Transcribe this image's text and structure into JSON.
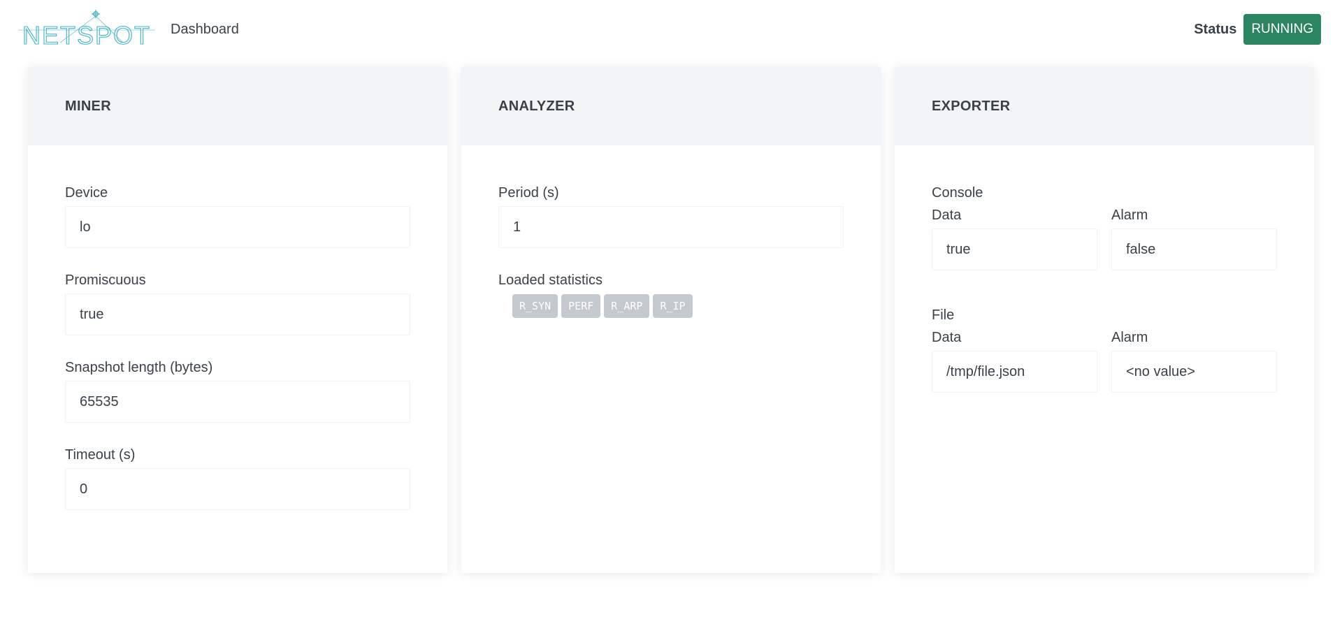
{
  "header": {
    "logo_text": "NETSPOT",
    "nav_dashboard": "Dashboard",
    "status_label": "Status",
    "status_value": "RUNNING"
  },
  "colors": {
    "status_running": "#2a8560",
    "logo": "#3fb3c7",
    "card_header_bg": "#f3f4f6",
    "tag_bg": "#c4c9cf"
  },
  "miner": {
    "title": "MINER",
    "fields": [
      {
        "label": "Device",
        "value": "lo"
      },
      {
        "label": "Promiscuous",
        "value": "true"
      },
      {
        "label": "Snapshot length (bytes)",
        "value": "65535"
      },
      {
        "label": "Timeout (s)",
        "value": "0"
      }
    ]
  },
  "analyzer": {
    "title": "ANALYZER",
    "period_label": "Period (s)",
    "period_value": "1",
    "stats_label": "Loaded statistics",
    "stats": [
      "R_SYN",
      "PERF",
      "R_ARP",
      "R_IP"
    ]
  },
  "exporter": {
    "title": "EXPORTER",
    "console": {
      "label": "Console",
      "data_label": "Data",
      "data_value": "true",
      "alarm_label": "Alarm",
      "alarm_value": "false"
    },
    "file": {
      "label": "File",
      "data_label": "Data",
      "data_value": "/tmp/file.json",
      "alarm_label": "Alarm",
      "alarm_value": "<no value>"
    }
  }
}
